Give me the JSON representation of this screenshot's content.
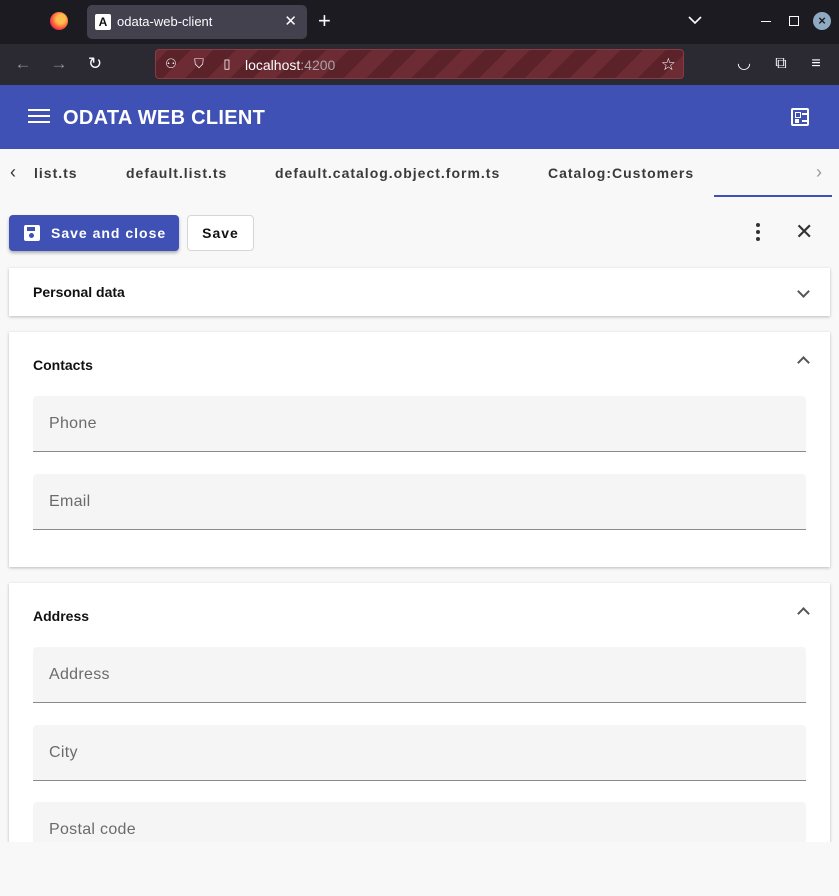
{
  "browser": {
    "tab_title": "odata-web-client",
    "tab_favicon": "A",
    "url_host": "localhost",
    "url_port": ":4200"
  },
  "app": {
    "title": "ODATA WEB CLIENT"
  },
  "tabs": [
    {
      "label": "list.ts"
    },
    {
      "label": "default.list.ts"
    },
    {
      "label": "default.catalog.object.form.ts"
    },
    {
      "label": "Catalog:Customers"
    }
  ],
  "actions": {
    "save_and_close": "Save and close",
    "save": "Save"
  },
  "panels": {
    "personal": {
      "title": "Personal data"
    },
    "contacts": {
      "title": "Contacts",
      "fields": [
        "Phone",
        "Email"
      ]
    },
    "address": {
      "title": "Address",
      "fields": [
        "Address",
        "City",
        "Postal code"
      ]
    }
  },
  "colors": {
    "primary": "#3f51b5"
  }
}
